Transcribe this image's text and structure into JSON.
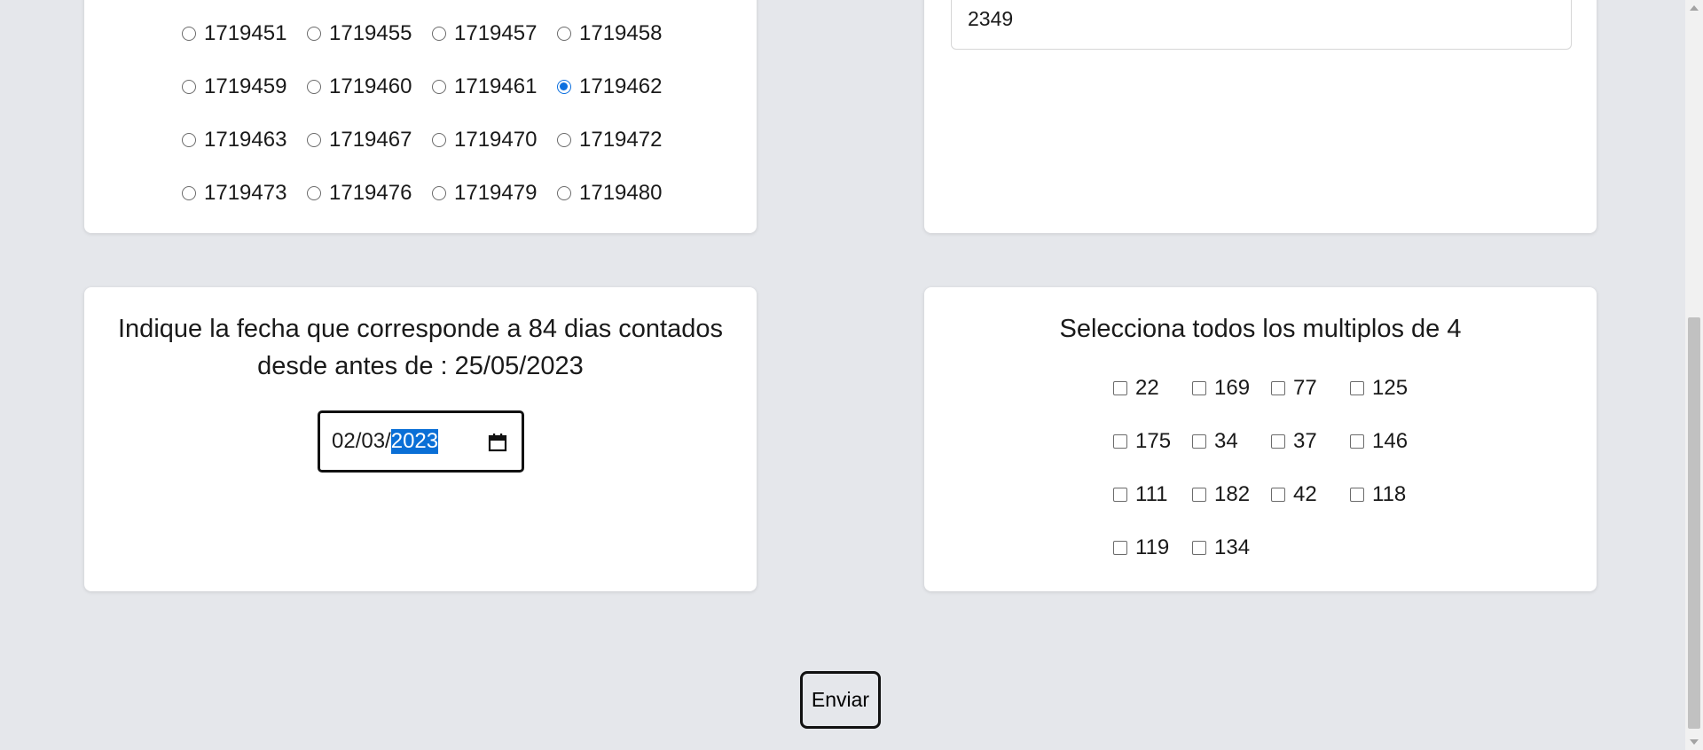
{
  "radio_question": {
    "rows": [
      [
        {
          "label": "1719451",
          "checked": false
        },
        {
          "label": "1719455",
          "checked": false
        },
        {
          "label": "1719457",
          "checked": false
        },
        {
          "label": "1719458",
          "checked": false
        }
      ],
      [
        {
          "label": "1719459",
          "checked": false
        },
        {
          "label": "1719460",
          "checked": false
        },
        {
          "label": "1719461",
          "checked": false
        },
        {
          "label": "1719462",
          "checked": true
        }
      ],
      [
        {
          "label": "1719463",
          "checked": false
        },
        {
          "label": "1719467",
          "checked": false
        },
        {
          "label": "1719470",
          "checked": false
        },
        {
          "label": "1719472",
          "checked": false
        }
      ],
      [
        {
          "label": "1719473",
          "checked": false
        },
        {
          "label": "1719476",
          "checked": false
        },
        {
          "label": "1719479",
          "checked": false
        },
        {
          "label": "1719480",
          "checked": false
        }
      ]
    ]
  },
  "text_question": {
    "value": "2349"
  },
  "date_question": {
    "prompt_line1": "Indique la fecha que corresponde a 84 dias contados",
    "prompt_line2": "desde antes de : 25/05/2023",
    "value_prefix": "02/03/",
    "value_selected": "2023",
    "icon": "calendar-icon"
  },
  "multiples_question": {
    "prompt": "Selecciona todos los multiplos de 4",
    "rows": [
      [
        {
          "label": "22",
          "checked": false
        },
        {
          "label": "169",
          "checked": false
        },
        {
          "label": "77",
          "checked": false
        },
        {
          "label": "125",
          "checked": false
        }
      ],
      [
        {
          "label": "175",
          "checked": false
        },
        {
          "label": "34",
          "checked": false
        },
        {
          "label": "37",
          "checked": false
        },
        {
          "label": "146",
          "checked": false
        }
      ],
      [
        {
          "label": "111",
          "checked": false
        },
        {
          "label": "182",
          "checked": false
        },
        {
          "label": "42",
          "checked": false
        },
        {
          "label": "118",
          "checked": false
        }
      ],
      [
        {
          "label": "119",
          "checked": false
        },
        {
          "label": "134",
          "checked": false
        }
      ]
    ]
  },
  "submit": {
    "label": "Enviar"
  },
  "colors": {
    "background": "#e5e7eb",
    "card": "#ffffff",
    "accent": "#0b6fdf",
    "selection": "#0a6fd6"
  }
}
